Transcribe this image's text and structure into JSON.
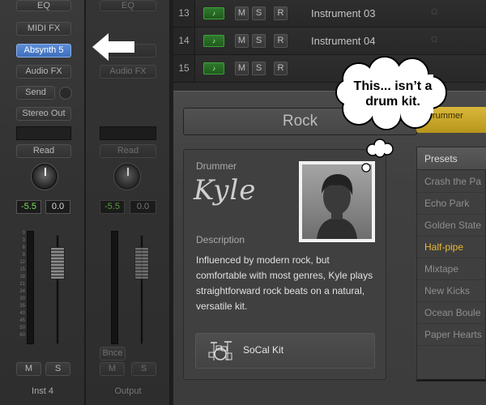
{
  "strip_left": {
    "eq": "EQ",
    "midi_fx": "MIDI FX",
    "instrument": "Absynth 5",
    "audio_fx": "Audio FX",
    "send": "Send",
    "output": "Stereo Out",
    "automation": "Read",
    "pan_value": "-5.5",
    "volume_value": "0.0",
    "mute": "M",
    "solo": "S",
    "name": "Inst 4"
  },
  "strip_right": {
    "eq": "EQ",
    "audio_fx": "Audio FX",
    "automation": "Read",
    "pan_value": "-5.5",
    "volume_value": "0.0",
    "bounce": "Bnce",
    "mute": "M",
    "solo": "S",
    "name": "Output"
  },
  "meter_scale": [
    "0",
    "3",
    "6",
    "9",
    "12",
    "15",
    "18",
    "21",
    "24",
    "30",
    "35",
    "40",
    "45",
    "50",
    "60"
  ],
  "tracks": [
    {
      "number": "13",
      "mute": "M",
      "solo": "S",
      "record": "R",
      "name": "Instrument 03"
    },
    {
      "number": "14",
      "mute": "M",
      "solo": "S",
      "record": "R",
      "name": "Instrument 04"
    },
    {
      "number": "15",
      "mute": "M",
      "solo": "S",
      "record": "R",
      "name": ""
    }
  ],
  "editor": {
    "genre": "Rock",
    "drummer_label": "Drummer",
    "drummer_name": "Kyle",
    "description_label": "Description",
    "description": "Influenced by modern rock, but comfortable with most genres, Kyle plays straightforward rock beats on a natural, versatile kit.",
    "kit_name": "SoCal Kit"
  },
  "presets": {
    "tab_label": "Drummer",
    "header": "Presets",
    "items": [
      "Crash the Pa",
      "Echo Park",
      "Golden State",
      "Half-pipe",
      "Mixtape",
      "New Kicks",
      "Ocean Boule",
      "Paper Hearts"
    ],
    "selected": "Half-pipe"
  },
  "callout": {
    "text": "This... isn’t a drum kit."
  },
  "colors": {
    "accent_blue": "#4a7ccb",
    "preset_selected": "#e8b830",
    "region_green": "#2f7a2c",
    "drummer_tab": "#d9b83a"
  }
}
